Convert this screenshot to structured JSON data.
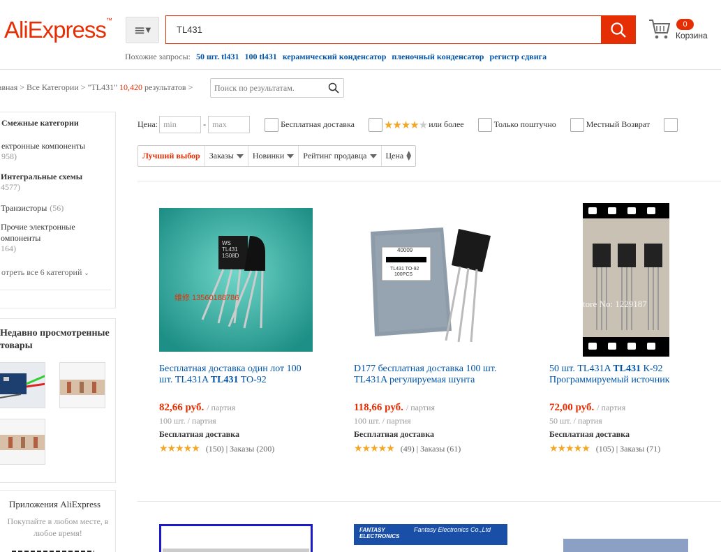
{
  "header": {
    "logo": "AliExpress",
    "logo_tm": "™",
    "search_value": "TL431",
    "cart_count": "0",
    "cart_label": "Корзина",
    "related_label": "Похожие запросы:",
    "related": [
      "50 шт. tl431",
      "100 tl431",
      "керамический конденсатор",
      "пленочный конденсатор",
      "регистр сдвига"
    ]
  },
  "breadcrumb": {
    "home": "авная",
    "sep": ">",
    "all": "Все Категории",
    "query": "\"TL431\"",
    "count": "10,420",
    "results": "результатов",
    "refine_placeholder": "Поиск по результатам."
  },
  "sidebar": {
    "related_title": "Смежные категории",
    "categories": [
      {
        "label": "ектронные компоненты",
        "count": "958)"
      },
      {
        "label": "Интегральные схемы",
        "count": "4577)"
      },
      {
        "label": "Транзисторы",
        "count": "(56)"
      },
      {
        "label": "Прочие электронные",
        "label2": "омпоненты",
        "count": "164)"
      }
    ],
    "see_all": "отреть все 6 категорий",
    "recent_title": "Недавно просмотренные",
    "recent_title2": "товары",
    "app_title": "Приложения AliExpress",
    "app_sub": "Покупайте в любом месте, в",
    "app_sub2": "любое время!"
  },
  "filters": {
    "price_label": "Цена:",
    "min_placeholder": "min",
    "dash": "-",
    "max_placeholder": "max",
    "free_shipping": "Бесплатная доставка",
    "stars_more": "или более",
    "single": "Только поштучно",
    "local_return": "Местный Возврат"
  },
  "sort": {
    "best": "Лучший выбор",
    "orders": "Заказы",
    "newest": "Новинки",
    "seller_rating": "Рейтинг продавца",
    "price": "Цена"
  },
  "products": [
    {
      "title_1": "Бесплатная доставка один лот 100",
      "title_2a": "шт. TL431A ",
      "title_2b": "TL431",
      "title_2c": " TO-92",
      "price": "82,66 руб.",
      "unit": "/ партия",
      "lot": "100 шт. / партия",
      "shipping": "Бесплатная доставка",
      "reviews": "(150)",
      "orders": "| Заказы (200)",
      "img_text1": "WS TL431 1S08D",
      "img_watermark": "维修 13560188786"
    },
    {
      "title_1": "D177 бесплатная доставка 100 шт.",
      "title_2a": "TL431A регулируемая шунта",
      "title_2b": "",
      "title_2c": "",
      "price": "118,66 руб.",
      "unit": "/ партия",
      "lot": "100 шт. / партия",
      "shipping": "Бесплатная доставка",
      "reviews": "(49)",
      "orders": "| Заказы (61)",
      "img_text1": "40009",
      "img_text2": "TL431 TO-92",
      "img_text3": "100PCS"
    },
    {
      "title_1a": "50 шт. TL431A ",
      "title_1b": "TL431",
      "title_1c": " К-92",
      "title_2a": "Программируемый источник",
      "price": "72,00 руб.",
      "unit": "/ партия",
      "lot": "50 шт. / партия",
      "shipping": "Бесплатная доставка",
      "reviews": "(105)",
      "orders": "| Заказы (71)",
      "img_text": "tore No: 1229187"
    }
  ],
  "row2": {
    "banner_text1": "FANTASY",
    "banner_text2": "ELECTRONICS",
    "banner_text3": "Fantasy Electronics Co.,Ltd"
  },
  "colors": {
    "accent": "#e62e04",
    "link": "#0055aa",
    "star": "#f5a623"
  }
}
